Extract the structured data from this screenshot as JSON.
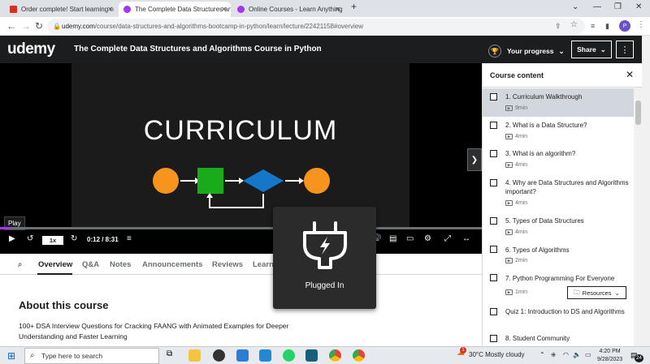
{
  "browser": {
    "tabs": [
      {
        "title": "Order complete! Start learning n",
        "icon_color": "#d93025"
      },
      {
        "title": "The Complete Data Structures an",
        "icon_color": "#a435f0"
      },
      {
        "title": "Online Courses - Learn Anything",
        "icon_color": "#a435f0"
      }
    ],
    "new_tab": "+",
    "url_domain": "udemy.com",
    "url_path": "/course/data-structures-and-algorithms-bootcamp-in-python/learn/lecture/22421158#overview",
    "profile_initial": "P"
  },
  "header": {
    "logo": "udemy",
    "course_title": "The Complete Data Structures and Algorithms Course in Python",
    "progress_label": "Your progress",
    "share_label": "Share"
  },
  "video": {
    "slide_title": "CURRICULUM",
    "play_tooltip": "Play",
    "speed": "1x",
    "time": "0:12 / 8:31",
    "progress_fraction": 0.023
  },
  "content_tabs": [
    "Overview",
    "Q&A",
    "Notes",
    "Announcements",
    "Reviews",
    "Learning tools"
  ],
  "about": {
    "heading": "About this course",
    "description": "100+ DSA Interview Questions for Cracking FAANG with Animated Examples for Deeper Understanding and Faster Learning"
  },
  "sidebar": {
    "title": "Course content",
    "items": [
      {
        "title": "1. Curriculum Walkthrough",
        "duration": "9min",
        "active": true
      },
      {
        "title": "2. What is a Data Structure?",
        "duration": "4min"
      },
      {
        "title": "3. What is an algorithm?",
        "duration": "4min"
      },
      {
        "title": "4. Why are Data Structures and Algorithms important?",
        "duration": "4min"
      },
      {
        "title": "5. Types of Data Structures",
        "duration": "4min"
      },
      {
        "title": "6. Types of Algorithms",
        "duration": "2min"
      },
      {
        "title": "7. Python Programming For Everyone",
        "duration": "1min",
        "resources": "Resources"
      },
      {
        "title": "Quiz 1: Introduction to DS and Algorithms",
        "duration": ""
      },
      {
        "title": "8. Student Community",
        "duration": ""
      }
    ]
  },
  "popup": {
    "label": "Plugged In"
  },
  "taskbar": {
    "search_placeholder": "Type here to search",
    "weather": "30°C  Mostly cloudy",
    "weather_badge": "1",
    "time": "4:20 PM",
    "date": "9/28/2023",
    "notification_count": "24"
  },
  "colors": {
    "accent": "#a435f0",
    "orange": "#f7941d",
    "green": "#1aab1a",
    "blue": "#1477c8"
  }
}
